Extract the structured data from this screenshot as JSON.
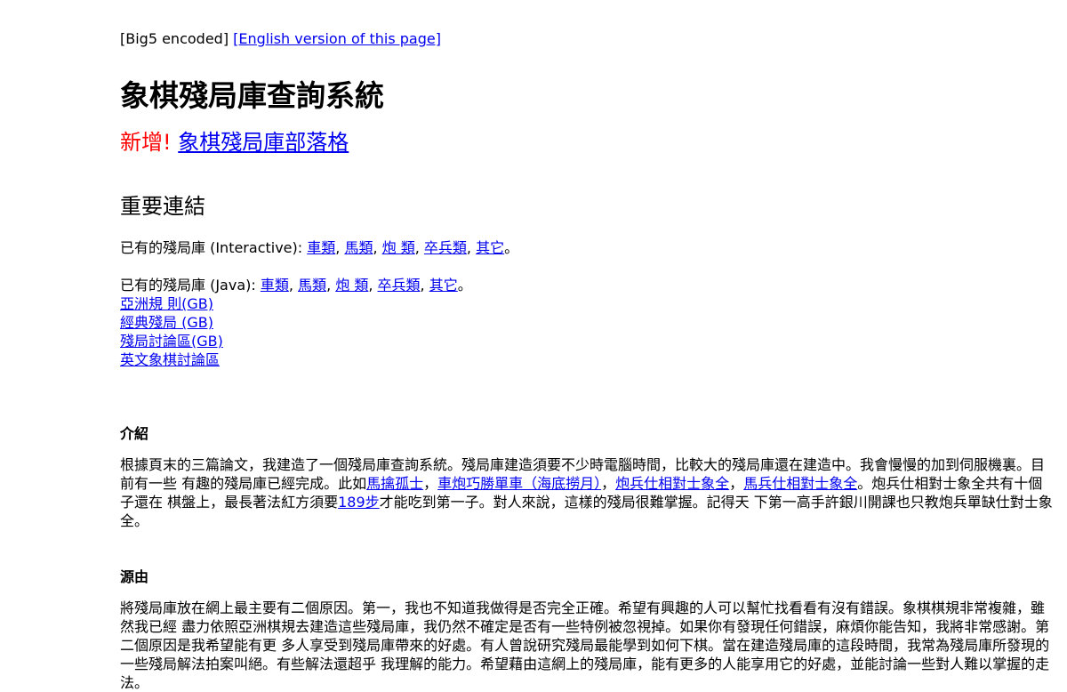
{
  "header": {
    "encoding_note": "[Big5 encoded]",
    "english_link": "[English version of this page]"
  },
  "title": "象棋殘局庫查詢系統",
  "new_line": {
    "prefix": "新增!",
    "link": "象棋殘局庫部落格"
  },
  "links_section": {
    "heading": "重要連結",
    "interactive": {
      "label": "已有的殘局庫 (Interactive):",
      "items": [
        "車類",
        "馬類",
        "炮 類",
        "卒兵類",
        "其它"
      ],
      "end": "。"
    },
    "java": {
      "label": "已有的殘局庫 (Java):",
      "items": [
        "車類",
        "馬類",
        "炮 類",
        "卒兵類",
        "其它"
      ],
      "end": "。"
    },
    "other_links": [
      "亞洲規 則(GB)",
      "經典殘局 (GB)",
      "殘局討論區(GB)",
      "英文象棋討論區"
    ]
  },
  "intro": {
    "heading": "介紹",
    "text1": "根據頁末的三篇論文，我建造了一個殘局庫查詢系統。殘局庫建造須要不少時電腦時間，比較大的殘局庫還在建造中。我會慢慢的加到伺服機裏。目前有一些 有趣的殘局庫已經完成。此如",
    "link1": "馬擒孤士",
    "sep1": "，",
    "link2": "車炮巧勝單車（海底撈月）",
    "sep2": "，",
    "link3": "炮兵仕相對士象全",
    "sep3": "，",
    "link4": "馬兵仕相對士象全",
    "text2": "。炮兵仕相對士象全共有十個子還在 棋盤上，最長著法紅方須要",
    "link5": "189步",
    "text3": "才能吃到第一子。對人來說，這樣的殘局很難掌握。記得天 下第一高手許銀川開課也只教炮兵單缺仕對士象全。"
  },
  "source": {
    "heading": "源由",
    "text": "將殘局庫放在網上最主要有二個原因。第一，我也不知道我做得是否完全正確。希望有興趣的人可以幫忙找看看有沒有錯誤。象棋棋規非常複雜，雖然我已經 盡力依照亞洲棋規去建造這些殘局庫，我仍然不確定是否有一些特例被忽視掉。如果你有發現任何錯誤，麻煩你能告知，我將非常感謝。第二個原因是我希望能有更 多人享受到殘局庫帶來的好處。有人曾說研究殘局最能學到如何下棋。當在建造殘局庫的這段時間，我常為殘局庫所發現的一些殘局解法拍案叫絕。有些解法還超乎 我理解的能力。希望藉由這網上的殘局庫，能有更多的人能享用它的好處，並能討論一些對人難以掌握的走法。"
  }
}
